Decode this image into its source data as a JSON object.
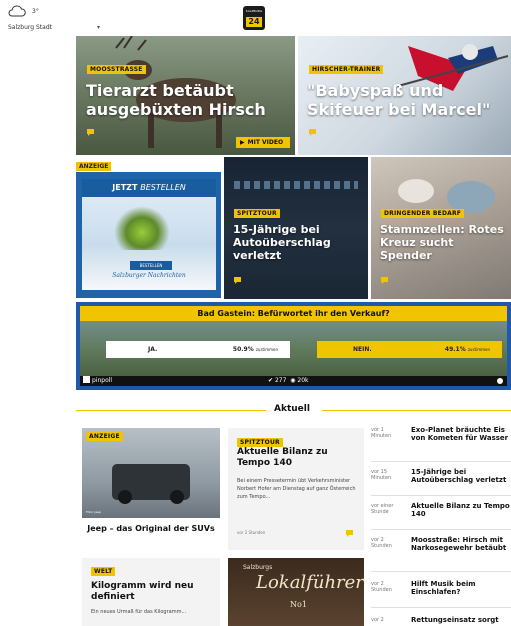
{
  "header": {
    "temperature": "3°",
    "location": "Salzburg Stadt",
    "chevron": "▾",
    "logo_top": "SALZBURG",
    "logo_num": "24"
  },
  "hero": [
    {
      "tag": "MOOSSTRASSE",
      "headline": "Tierarzt betäubt ausgebüxten Hirsch",
      "video_label": "MIT VIDEO"
    },
    {
      "tag": "HIRSCHER-TRAINER",
      "headline": "\"Babyspaß und Skifeuer bei Marcel\""
    }
  ],
  "ad_label": "ANZEIGE",
  "ad": {
    "bar_a": "JETZT",
    "bar_b": "BESTELLEN",
    "button": "BESTELLEN",
    "brand": "Salzburger Nachrichten"
  },
  "mid": [
    {
      "tag": "SPITZTOUR",
      "headline": "15-Jährige bei Autoüberschlag verletzt"
    },
    {
      "tag": "DRINGENDER BEDARF",
      "headline": "Stammzellen: Rotes Kreuz sucht Spender"
    }
  ],
  "poll": {
    "question": "Bad Gastein: Befürwortet ihr den Verkauf?",
    "options": [
      {
        "label": "JA.",
        "pct": "50.9%",
        "note": "zustimmen",
        "fraction": 0.509
      },
      {
        "label": "NEIN.",
        "pct": "49.1%",
        "note": "zustimmen",
        "fraction": 0.491
      }
    ],
    "brand": "pinpoll",
    "votes": "277",
    "views": "20k"
  },
  "section_title": "Aktuell",
  "cards": {
    "jeep": {
      "tag": "ANZEIGE",
      "title": "Jeep – das Original der SUVs",
      "credit": "Foto: Jeep"
    },
    "bilanz": {
      "tag": "SPITZTOUR",
      "title": "Aktuelle Bilanz zu Tempo 140",
      "body": "Bei einem Pressetermin übt Verkehrsminister Norbert Hofer am Dienstag auf ganz Österreich zum Tempo...",
      "date": "vor 2 Stunden"
    },
    "kilo": {
      "tag": "WELT",
      "title": "Kilogramm wird neu definiert",
      "body": "Ein neues Urmaß für das Kilogramm..."
    },
    "lokal": {
      "line1": "Salzburgs",
      "line2": "Lokalführer",
      "line3": "No1"
    }
  },
  "news_list": [
    {
      "time": "vor 1 Minuten",
      "headline": "Exo-Planet bräuchte Eis von Kometen für Wasser"
    },
    {
      "time": "vor 15 Minuten",
      "headline": "15-Jährige bei Autoüberschlag verletzt"
    },
    {
      "time": "vor einer Stunde",
      "headline": "Aktuelle Bilanz zu Tempo 140"
    },
    {
      "time": "vor 2 Stunden",
      "headline": "Moosstraße: Hirsch mit Narkosegewehr betäubt"
    },
    {
      "time": "vor 2 Stunden",
      "headline": "Hilft Musik beim Einschlafen?"
    },
    {
      "time": "vor 2",
      "headline": "Rettungseinsatz sorgt"
    }
  ],
  "colors": {
    "accent": "#f0c400",
    "brand_blue": "#1e5aa8"
  }
}
